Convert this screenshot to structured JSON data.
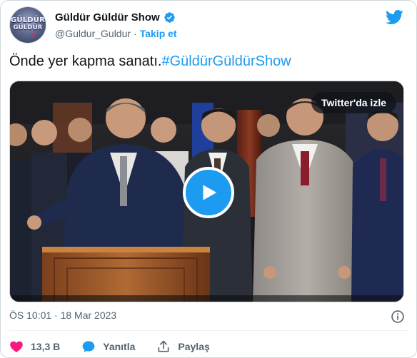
{
  "account": {
    "display_name": "Güldür Güldür Show",
    "handle": "@Guldur_Guldur",
    "separator": "·",
    "follow_label": "Takip et",
    "avatar_text_line1": "GÜLDÜR",
    "avatar_text_line2": "GÜLDÜR",
    "verified_icon": "verified-badge-icon",
    "brand_icon": "twitter-bird-icon"
  },
  "tweet": {
    "text": "Önde yer kapma sanatı.",
    "hashtag": "#GüldürGüldürShow"
  },
  "media": {
    "type": "video",
    "watch_label": "Twitter'da izle",
    "play_icon": "play-icon"
  },
  "meta": {
    "timestamp": "ÖS 10:01 · 18 Mar 2023",
    "info_icon": "info-icon"
  },
  "actions": {
    "like_count": "13,3 B",
    "reply_label": "Yanıtla",
    "share_label": "Paylaş"
  },
  "colors": {
    "accent": "#1d9bf0",
    "like": "#f91880",
    "text_primary": "#0f1419",
    "text_secondary": "#536471"
  }
}
